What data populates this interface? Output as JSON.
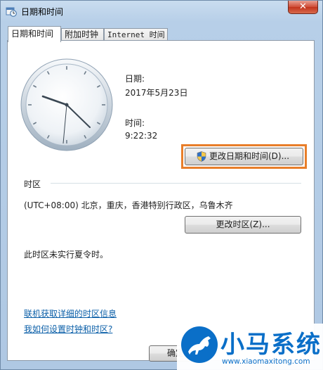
{
  "window": {
    "title": "日期和时间",
    "close_label": "✕"
  },
  "tabs": [
    {
      "label": "日期和时间",
      "active": true
    },
    {
      "label": "附加时钟",
      "active": false
    },
    {
      "label": "Internet 时间",
      "active": false
    }
  ],
  "datetime": {
    "date_label": "日期:",
    "date_value": "2017年5月23日",
    "time_label": "时间:",
    "time_value": "9:22:32",
    "change_button": "更改日期和时间(D)..."
  },
  "timezone": {
    "section_label": "时区",
    "value": "(UTC+08:00) 北京，重庆，香港特别行政区，乌鲁木齐",
    "change_button": "更改时区(Z)...",
    "dst_note": "此时区未实行夏令时。"
  },
  "links": {
    "online_info": "联机获取详细的时区信息",
    "how_to": "我如何设置时钟和时区?"
  },
  "footer": {
    "ok_button": "确定"
  },
  "watermark": {
    "brand": "小马系统",
    "url": "www.xiaomaxitong.com"
  },
  "colors": {
    "highlight": "#e87e2a",
    "link": "#0b5fa8",
    "brand": "#0a6fc8"
  }
}
